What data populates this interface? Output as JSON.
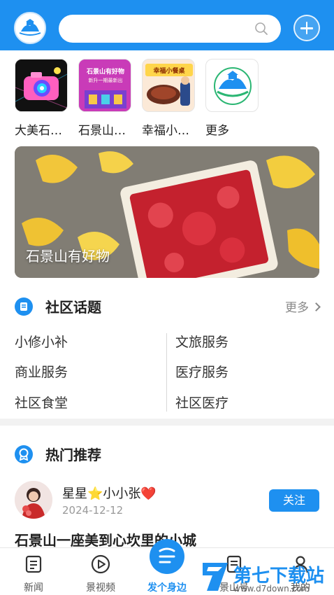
{
  "header": {
    "search_placeholder": ""
  },
  "apps": [
    {
      "label": "大美石…",
      "icon": "camera-app-thumb"
    },
    {
      "label": "石景山…",
      "icon": "shop-app-thumb",
      "thumb_text_line1": "石景山有好物",
      "thumb_text_line2": "新升一期最新出"
    },
    {
      "label": "幸福小…",
      "icon": "restaurant-app-thumb",
      "thumb_text": "幸福小餐桌"
    },
    {
      "label": "更多",
      "icon": "more-app-thumb"
    }
  ],
  "banner": {
    "caption": "石景山有好物"
  },
  "community": {
    "title": "社区话题",
    "more_label": "更多",
    "topics_left": [
      "小修小补",
      "商业服务",
      "社区食堂"
    ],
    "topics_right": [
      "文旅服务",
      "医疗服务",
      "社区医疗"
    ]
  },
  "hot": {
    "title": "热门推荐"
  },
  "post": {
    "username": "星星⭐小小张❤️",
    "date": "2024-12-12",
    "follow_label": "关注",
    "title": "石景山一座美到心坎里的小城"
  },
  "nav": [
    {
      "label": "新闻",
      "icon": "news-icon"
    },
    {
      "label": "景视频",
      "icon": "video-play-icon"
    },
    {
      "label": "发个身边",
      "icon": "post-nearby-icon"
    },
    {
      "label": "景山号",
      "icon": "account-icon"
    },
    {
      "label": "我的",
      "icon": "profile-icon"
    }
  ],
  "watermark": {
    "title": "第七下载站",
    "url": "www.d7down.com"
  },
  "colors": {
    "primary": "#1e90f0",
    "text": "#222222",
    "muted": "#999999"
  }
}
